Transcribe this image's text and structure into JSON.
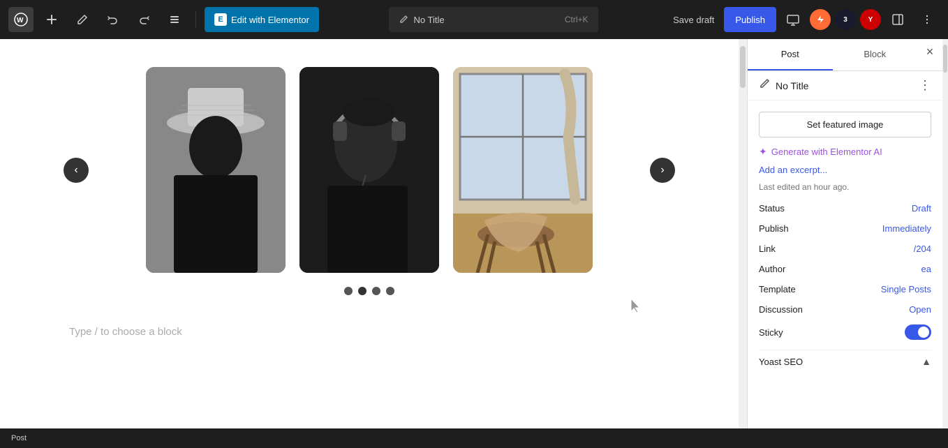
{
  "toolbar": {
    "wp_logo_label": "WordPress",
    "add_button_label": "+",
    "undo_label": "Undo",
    "redo_label": "Redo",
    "list_view_label": "List View",
    "elementor_button_label": "Edit with Elementor",
    "elementor_prefix": "E",
    "post_title": "No Title",
    "shortcut": "Ctrl+K",
    "save_draft_label": "Save draft",
    "publish_label": "Publish",
    "more_tools_label": "More tools"
  },
  "editor": {
    "placeholder_text": "Type / to choose a block",
    "slider": {
      "prev_label": "‹",
      "next_label": "›",
      "dots": [
        {
          "active": false
        },
        {
          "active": true
        },
        {
          "active": false
        },
        {
          "active": false
        }
      ],
      "images": [
        {
          "type": "woman-hat",
          "alt": "Woman with hat"
        },
        {
          "type": "headphones",
          "alt": "Person with headphones"
        },
        {
          "type": "chair",
          "alt": "Chair by window"
        }
      ]
    }
  },
  "sidebar": {
    "tab_post": "Post",
    "tab_block": "Block",
    "close_label": "×",
    "post_title": "No Title",
    "more_options_label": "⋮",
    "set_featured_image_label": "Set featured image",
    "generate_ai_label": "Generate with Elementor AI",
    "add_excerpt_label": "Add an excerpt...",
    "last_edited_label": "Last edited an hour ago.",
    "meta": [
      {
        "label": "Status",
        "value": "Draft"
      },
      {
        "label": "Publish",
        "value": "Immediately"
      },
      {
        "label": "Link",
        "value": "/204"
      },
      {
        "label": "Author",
        "value": "ea"
      },
      {
        "label": "Template",
        "value": "Single Posts"
      },
      {
        "label": "Discussion",
        "value": "Open"
      }
    ],
    "sticky_label": "Sticky",
    "sticky_value": "on",
    "yoast_section_label": "Yoast SEO",
    "chevron_label": "▲"
  },
  "status_bar": {
    "label": "Post"
  },
  "colors": {
    "accent": "#3858e9",
    "link": "#3858e9",
    "ai_purple": "#9b51e0",
    "toolbar_bg": "#1e1e1e",
    "sidebar_bg": "#ffffff",
    "toggle_on": "#3858e9"
  }
}
